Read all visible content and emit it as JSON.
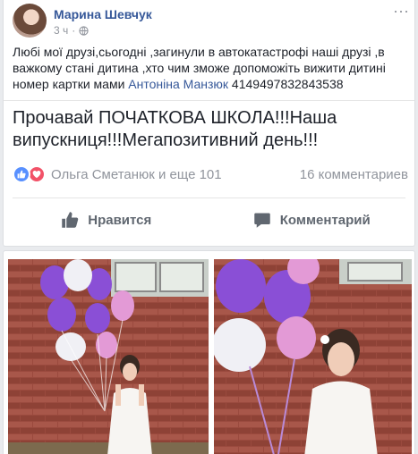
{
  "post": {
    "author": "Марина Шевчук",
    "time": "3 ч",
    "more": "···",
    "text_main": "Любі мої друзі,сьогодні ,загинули в автокатастрофі наші друзі ,в важкому стані дитина ,хто чим зможе допоможіть вижити дитині номер картки мами ",
    "text_link": "Антоніна Манзюк",
    "text_number": " 4149497832843538",
    "shared_text": "Прочавай ПОЧАТКОВА ШКОЛА!!!Наша випускниця!!!Мегапозитивний день!!!"
  },
  "reactions": {
    "names": "Ольга Сметанюк и еще 101",
    "comments": "16 комментариев"
  },
  "actions": {
    "like": "Нравится",
    "comment": "Комментарий"
  },
  "icons": {
    "globe": "globe-icon",
    "like": "thumbs-up-icon",
    "love": "heart-icon",
    "comment": "speech-bubble-icon"
  },
  "colors": {
    "link": "#365899",
    "like_reaction": "#5890ff",
    "love_reaction": "#f25268",
    "balloon_purple": "#8a4fd6",
    "balloon_pink": "#e39ad6"
  }
}
